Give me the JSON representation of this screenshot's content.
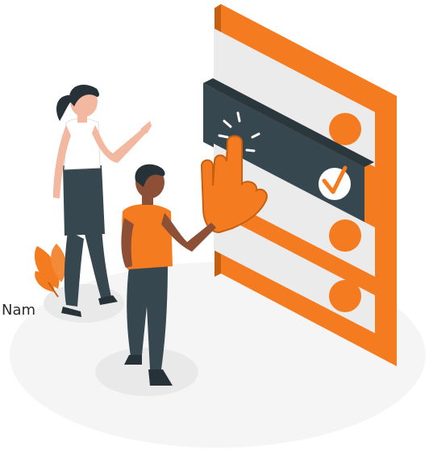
{
  "caption": "Nam",
  "colors": {
    "accent": "#f47b20",
    "dark": "#37474f",
    "panel": "#ebebeb",
    "floor": "#f5f5f5",
    "skin_woman": "#f2b8a0",
    "skin_man": "#8d4f35",
    "hair": "#263238"
  },
  "icons": [
    "check-icon",
    "pointing-hand-icon",
    "click-burst-icon",
    "plant-decoration"
  ]
}
